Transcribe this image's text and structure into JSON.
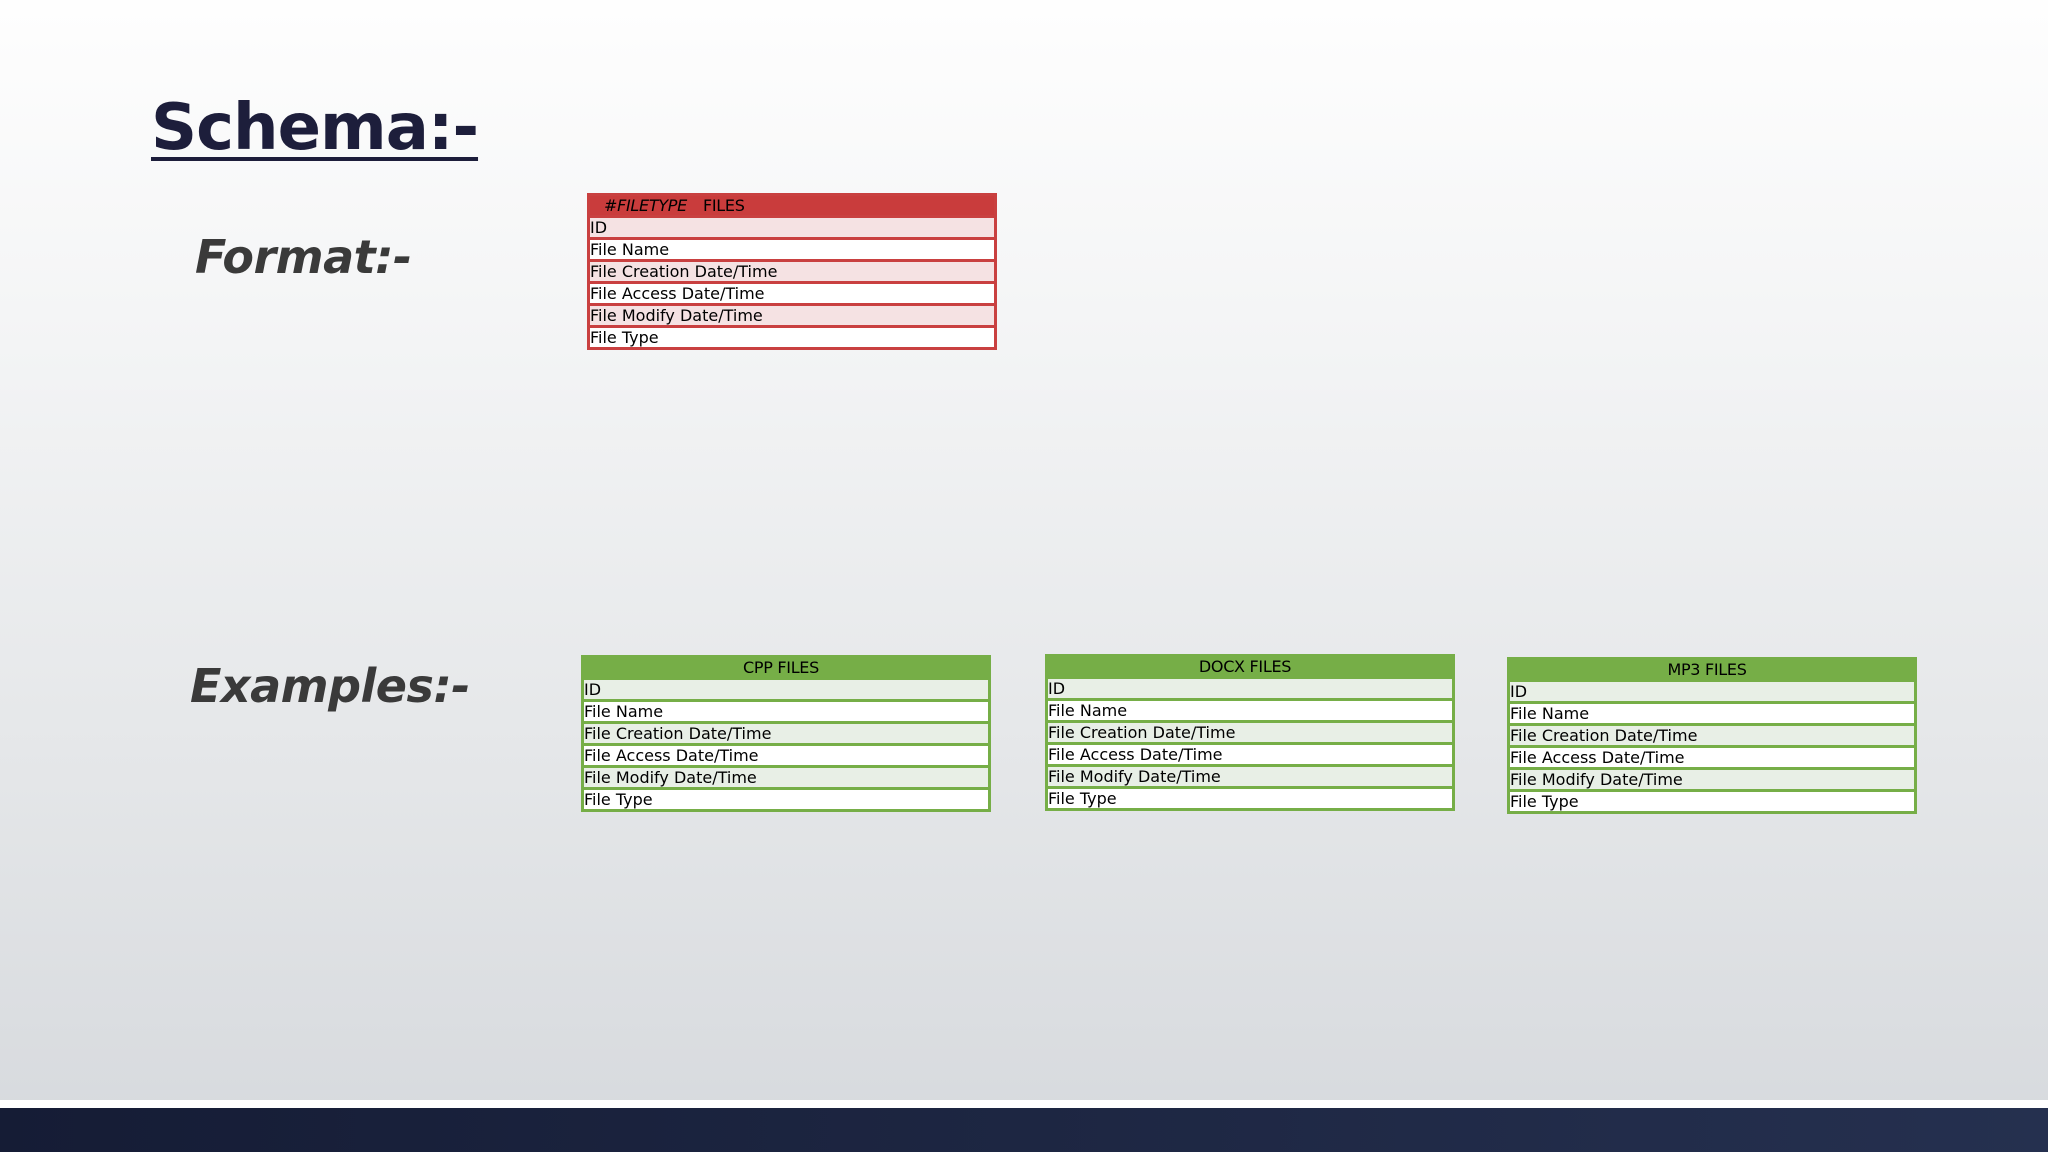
{
  "title": "Schema:-",
  "format_label": "Format:-",
  "examples_label": "Examples:-",
  "format_table": {
    "header_italic": "#FILETYPE",
    "header_plain": "FILES",
    "rows": [
      "ID",
      "File Name",
      "File Creation Date/Time",
      "File  Access Date/Time",
      "File Modify Date/Time",
      "File Type"
    ]
  },
  "examples": [
    {
      "header": "CPP FILES",
      "rows": [
        "ID",
        "File Name",
        "File Creation Date/Time",
        "File  Access Date/Time",
        "File Modify Date/Time",
        "File Type"
      ]
    },
    {
      "header": "DOCX FILES",
      "rows": [
        "ID",
        "File Name",
        "File Creation Date/Time",
        "File Access Date/Time",
        "File Modify Date/Time",
        "File Type"
      ]
    },
    {
      "header": "MP3 FILES",
      "rows": [
        "ID",
        "File Name",
        "File Creation Date/Time",
        "File Access Date/Time",
        "File Modify Date/Time",
        "File Type"
      ]
    }
  ],
  "colors": {
    "format_header": "#c93c3c",
    "format_row_tint": "#f5e2e3",
    "example_header": "#76ae47",
    "example_row_tint": "#e8efe6",
    "title_color": "#1d1e3b",
    "footer_band": "#1b233f"
  }
}
